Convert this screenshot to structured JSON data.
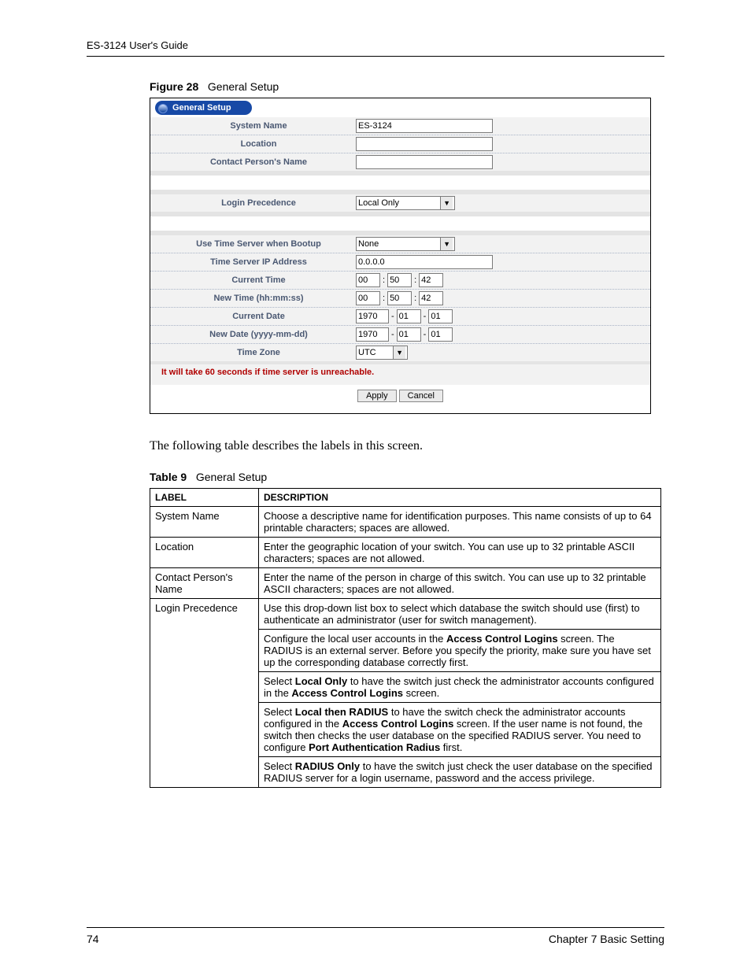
{
  "meta": {
    "guide": "ES-3124 User's Guide",
    "page_number": "74",
    "chapter": "Chapter 7 Basic Setting"
  },
  "figure": {
    "caption_label": "Figure 28",
    "caption_text": "General Setup",
    "title": "General Setup",
    "fields": {
      "system_name": {
        "label": "System Name",
        "value": "ES-3124"
      },
      "location": {
        "label": "Location",
        "value": ""
      },
      "contact_persons_name": {
        "label": "Contact Person's Name",
        "value": ""
      },
      "login_precedence": {
        "label": "Login Precedence",
        "value": "Local Only"
      },
      "use_time_server_when_bootup": {
        "label": "Use Time Server when Bootup",
        "value": "None"
      },
      "time_server_ip_address": {
        "label": "Time Server IP Address",
        "value": "0.0.0.0"
      },
      "current_time": {
        "label": "Current Time",
        "hh": "00",
        "mm": "50",
        "ss": "42"
      },
      "new_time": {
        "label": "New Time (hh:mm:ss)",
        "hh": "00",
        "mm": "50",
        "ss": "42"
      },
      "current_date": {
        "label": "Current Date",
        "yyyy": "1970",
        "mm": "01",
        "dd": "01"
      },
      "new_date": {
        "label": "New Date (yyyy-mm-dd)",
        "yyyy": "1970",
        "mm": "01",
        "dd": "01"
      },
      "time_zone": {
        "label": "Time Zone",
        "value": "UTC"
      }
    },
    "warning": "It will take 60 seconds if time server is unreachable.",
    "buttons": {
      "apply": "Apply",
      "cancel": "Cancel"
    }
  },
  "prose": "The following table describes the labels in this screen.",
  "table": {
    "caption_label": "Table 9",
    "caption_text": "General Setup",
    "headers": {
      "label": "LABEL",
      "desc": "DESCRIPTION"
    },
    "rows": [
      {
        "label": "System Name",
        "paras": [
          [
            {
              "t": "Choose a descriptive name for identification purposes. This name consists of up to 64 printable characters; spaces are allowed."
            }
          ]
        ]
      },
      {
        "label": "Location",
        "paras": [
          [
            {
              "t": "Enter the geographic location of your switch. You can use up to 32 printable ASCII characters; spaces are not allowed."
            }
          ]
        ]
      },
      {
        "label": "Contact Person's Name",
        "paras": [
          [
            {
              "t": "Enter the name of the person in charge of this switch. You can use up to 32 printable ASCII characters; spaces are not allowed."
            }
          ]
        ]
      },
      {
        "label": "Login Precedence",
        "paras": [
          [
            {
              "t": "Use this drop-down list box to select which database the switch should use (first) to authenticate an administrator (user for switch management)."
            }
          ],
          [
            {
              "t": "Configure the local user accounts in the "
            },
            {
              "t": "Access Control Logins",
              "b": true
            },
            {
              "t": " screen. The RADIUS is an external server. Before you specify the priority, make sure you have set up the corresponding database correctly first."
            }
          ],
          [
            {
              "t": "Select "
            },
            {
              "t": "Local Only",
              "b": true
            },
            {
              "t": " to have the switch just check the administrator accounts configured in the "
            },
            {
              "t": "Access Control Logins",
              "b": true
            },
            {
              "t": " screen."
            }
          ],
          [
            {
              "t": "Select "
            },
            {
              "t": "Local then RADIUS",
              "b": true
            },
            {
              "t": " to have the switch check the administrator accounts configured in the "
            },
            {
              "t": "Access Control Logins",
              "b": true
            },
            {
              "t": " screen. If the user name is not found, the switch then checks the user database on the specified RADIUS server. You need to configure "
            },
            {
              "t": "Port Authentication Radius",
              "b": true
            },
            {
              "t": " first."
            }
          ],
          [
            {
              "t": "Select "
            },
            {
              "t": "RADIUS Only",
              "b": true
            },
            {
              "t": " to have the switch just check the user database on the specified RADIUS server for a login username, password and the access privilege."
            }
          ]
        ]
      }
    ]
  }
}
